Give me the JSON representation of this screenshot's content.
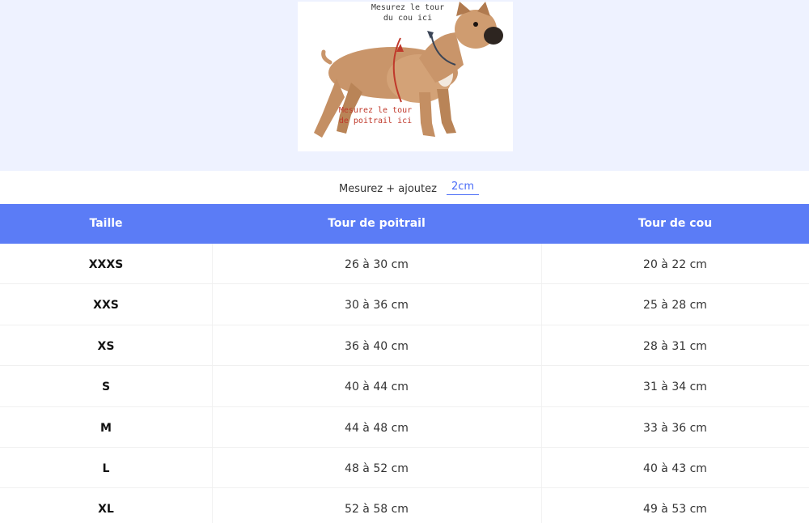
{
  "hero": {
    "note_neck": [
      "Mesurez le tour",
      "du cou ici"
    ],
    "note_chest": [
      "Mesurez le tour",
      "de poitrail ici"
    ],
    "colors": {
      "background": "#eef2ff",
      "neck_arrow": "#3b4556",
      "chest_arrow": "#c0392b"
    }
  },
  "measure": {
    "label": "Mesurez + ajoutez",
    "value": "2cm"
  },
  "table": {
    "headers": [
      "Taille",
      "Tour de poitrail",
      "Tour de cou"
    ],
    "rows": [
      {
        "size": "XXXS",
        "chest": "26 à 30 cm",
        "neck": "20 à 22 cm"
      },
      {
        "size": "XXS",
        "chest": "30 à 36 cm",
        "neck": "25 à 28 cm"
      },
      {
        "size": "XS",
        "chest": "36 à 40 cm",
        "neck": "28 à 31 cm"
      },
      {
        "size": "S",
        "chest": "40 à 44 cm",
        "neck": "31 à 34 cm"
      },
      {
        "size": "M",
        "chest": "44 à 48 cm",
        "neck": "33 à 36 cm"
      },
      {
        "size": "L",
        "chest": "48 à 52 cm",
        "neck": "40 à 43 cm"
      },
      {
        "size": "XL",
        "chest": "52 à 58 cm",
        "neck": "49 à 53 cm"
      }
    ],
    "colors": {
      "header_bg": "#5b7cf6",
      "accent": "#4a6cf7"
    }
  }
}
